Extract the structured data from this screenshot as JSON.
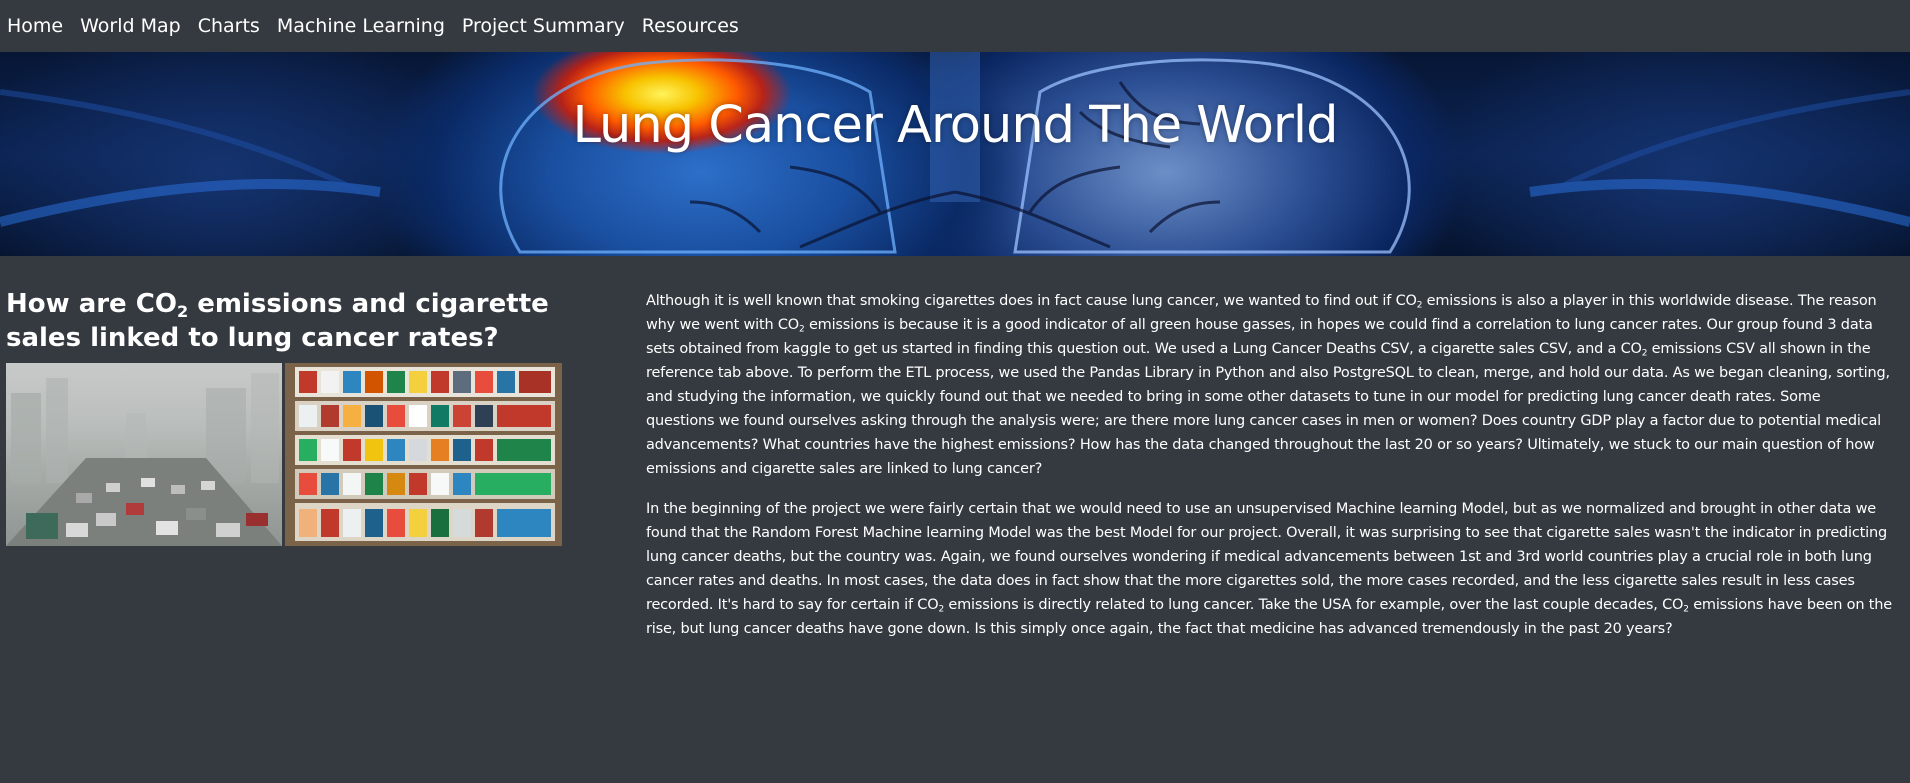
{
  "nav": {
    "items": [
      {
        "label": "Home"
      },
      {
        "label": "World Map"
      },
      {
        "label": "Charts"
      },
      {
        "label": "Machine Learning"
      },
      {
        "label": "Project Summary"
      },
      {
        "label": "Resources"
      }
    ]
  },
  "banner": {
    "title": "Lung Cancer Around The World"
  },
  "content": {
    "heading": {
      "part1": "How are CO",
      "sub": "2",
      "part2": " emissions and cigarette sales linked to lung cancer rates?"
    },
    "paragraph1": {
      "s1": "Although it is well known that smoking cigarettes does in fact cause lung cancer, we wanted to find out if CO",
      "s2": " emissions is also a player in this worldwide disease. The reason why we went with CO",
      "s3": " emissions is because it is a good indicator of all green house gasses, in hopes we could find a correlation to lung cancer rates. Our group found 3 data sets obtained from kaggle to get us started in finding this question out. We used a Lung Cancer Deaths CSV, a cigarette sales CSV, and a CO",
      "s4": " emissions CSV all shown in the reference tab above. To perform the ETL process, we used the Pandas Library in Python and also PostgreSQL to clean, merge, and hold our data. As we began cleaning, sorting, and studying the information, we quickly found out that we needed to bring in some other datasets to tune in our model for predicting lung cancer death rates. Some questions we found ourselves asking through the analysis were; are there more lung cancer cases in men or women? Does country GDP play a factor due to potential medical advancements? What countries have the highest emissions? How has the data changed throughout the last 20 or so years? Ultimately, we stuck to our main question of how emissions and cigarette sales are linked to lung cancer?"
    },
    "paragraph2": {
      "s1": "In the beginning of the project we were fairly certain that we would need to use an unsupervised Machine learning Model, but as we normalized and brought in other data we found that the Random Forest Machine learning Model was the best Model for our project. Overall, it was surprising to see that cigarette sales wasn't the indicator in predicting lung cancer deaths, but the country was. Again, we found ourselves wondering if medical advancements between 1st and 3rd world countries play a crucial role in both lung cancer rates and deaths. In most cases, the data does in fact show that the more cigarettes sold, the more cases recorded, and the less cigarette sales result in less cases recorded. It's hard to say for certain if CO",
      "s2": " emissions is directly related to lung cancer. Take the USA for example, over the last couple decades, CO",
      "s3": " emissions have been on the rise, but lung cancer deaths have gone down. Is this simply once again, the fact that medicine has advanced tremendously in the past 20 years?"
    },
    "subscript": "2"
  }
}
